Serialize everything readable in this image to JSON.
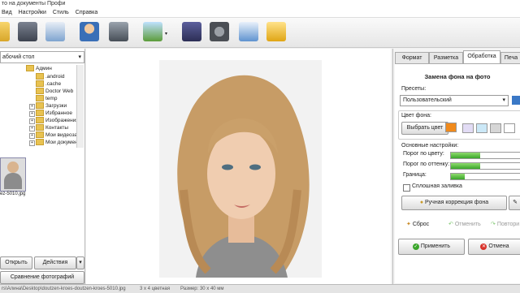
{
  "window": {
    "title": "то на документы Профи"
  },
  "menu": [
    "Вид",
    "Настройки",
    "Стиль",
    "Справка"
  ],
  "left": {
    "path": "абочий стол",
    "tree": [
      "Админ",
      ".android",
      ".cache",
      "Doctor Web",
      "temp",
      "Загрузки",
      "Избранное",
      "Изображения",
      "Контакты",
      "Мои видеоза",
      "Мои докумен"
    ],
    "thumb_caption": "ez-5010.jpg",
    "open_label": "Открыть",
    "actions_label": "Действия",
    "compare_label": "Сравнение фотографий"
  },
  "tabs": [
    "Формат",
    "Разметка",
    "Обработка",
    "Печа"
  ],
  "panel": {
    "title": "Замена фона на фото",
    "presets_label": "Пресеты:",
    "preset_value": "Пользовательский",
    "bg_color_label": "Цвет фона:",
    "pick_color_label": "Выбрать цвет",
    "main_settings_label": "Основные настройки:",
    "sliders": [
      {
        "label": "Порог по цвету:",
        "value": 0.42
      },
      {
        "label": "Порог по оттенку:",
        "value": 0.42
      },
      {
        "label": "Граница:",
        "value": 0.2
      }
    ],
    "solid_fill_label": "Сплошная заливка",
    "manual_label": "Ручная коррекция фона",
    "reset_label": "Сброс",
    "undo_label": "Отменить",
    "redo_label": "Повтори",
    "apply_label": "Применить",
    "cancel_label": "Отмена"
  },
  "colors": {
    "accent_orange": "#f08a1c",
    "apply_green": "#3aa52a",
    "cancel_red": "#d8322a"
  },
  "status": {
    "path": "rs\\Алина\\Desktop\\doutzen-kroes-doutzen-kroes-5010.jpg",
    "size_mult": "3 x 4 цветная",
    "dims": "Размер: 30 x 40 мм"
  }
}
